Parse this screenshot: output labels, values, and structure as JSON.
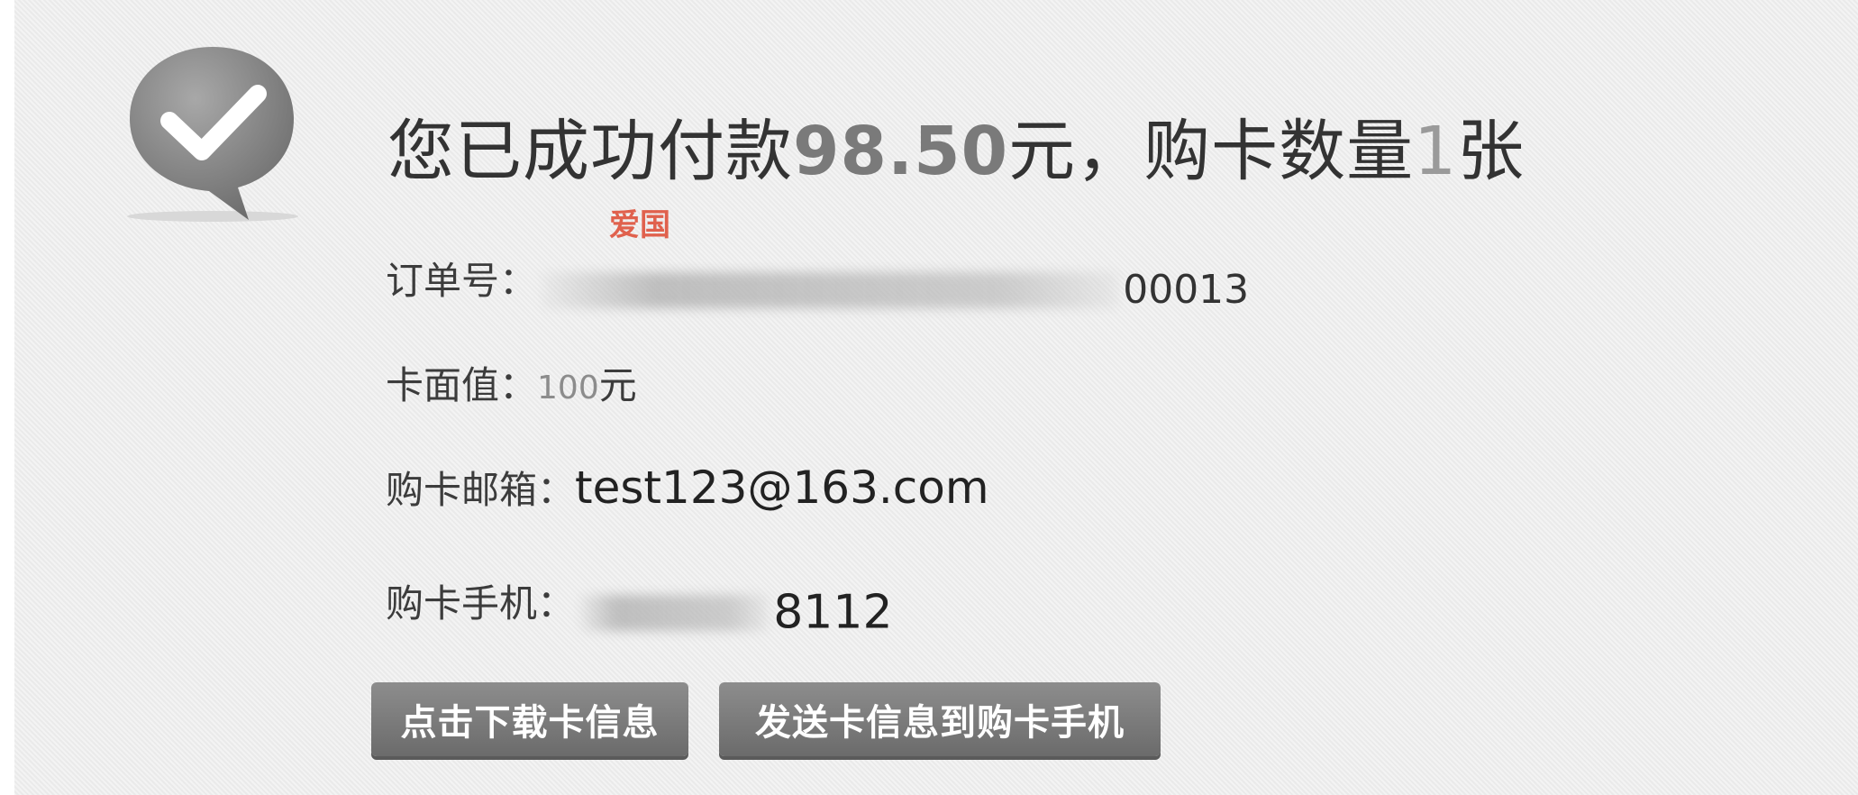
{
  "header": {
    "title_prefix": "您已成功付款",
    "amount": "98.50",
    "title_middle": "元，购卡数量",
    "count": "1",
    "title_suffix": "张"
  },
  "watermark": "爱国",
  "order": {
    "label": "订单号：",
    "suffix": "00013"
  },
  "face_value": {
    "label": "卡面值：",
    "value": "100",
    "unit": "元"
  },
  "email": {
    "label": "购卡邮箱：",
    "value": "test123@163.com"
  },
  "phone": {
    "label": "购卡手机：",
    "suffix": "8112"
  },
  "buttons": {
    "download": "点击下载卡信息",
    "send": "发送卡信息到购卡手机"
  },
  "icons": {
    "success": "check-speech-bubble-icon"
  },
  "colors": {
    "background": "#efefef",
    "button": "#7a7a7a",
    "watermark": "#e0614d"
  }
}
